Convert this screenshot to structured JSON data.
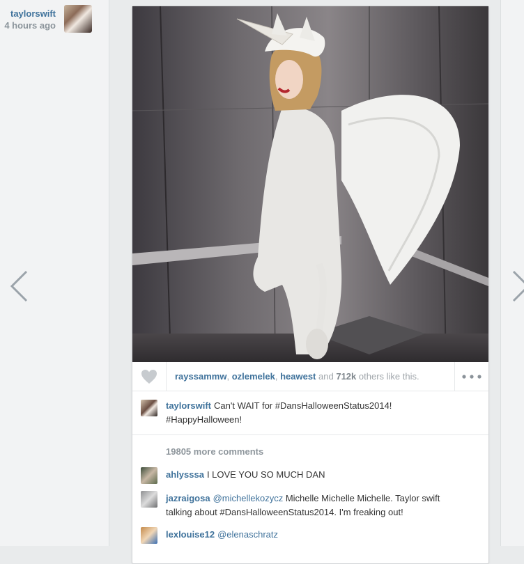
{
  "sidebar": {
    "username": "taylorswift",
    "time": "4 hours ago"
  },
  "nav": {
    "prev": "chevron-left",
    "next": "chevron-right"
  },
  "likes": {
    "users": [
      "rayssammw",
      "ozlemelek",
      "heawest"
    ],
    "and_word": "and",
    "count": "712k",
    "suffix": "others like this."
  },
  "caption": {
    "user": "taylorswift",
    "text_line1": "Can't WAIT for #DansHalloweenStatus2014!",
    "text_line2": "#HappyHalloween!"
  },
  "comments_header": {
    "count": "19805",
    "label": "more comments"
  },
  "comments": [
    {
      "user": "ahlysssa",
      "mention": "",
      "text": "I LOVE YOU SO MUCH DAN"
    },
    {
      "user": "jazraigosa",
      "mention": "@michellekozycz",
      "text": "Michelle Michelle Michelle. Taylor swift",
      "text2": "talking about #DansHalloweenStatus2014. I'm freaking out!"
    },
    {
      "user": "lexlouise12",
      "mention": "@elenaschratz",
      "text": ""
    }
  ],
  "colors": {
    "link": "#3f729b",
    "muted": "#8e969c"
  }
}
